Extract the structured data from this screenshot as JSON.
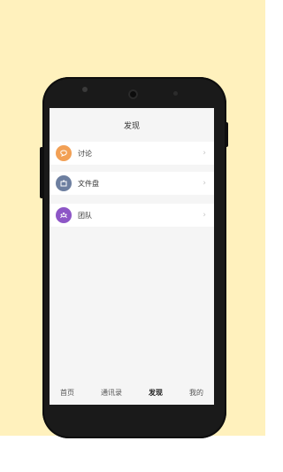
{
  "header": {
    "title": "发现"
  },
  "items": [
    {
      "label": "讨论",
      "icon": "discussion-icon",
      "color": "#f2a055"
    },
    {
      "label": "文件盘",
      "icon": "folder-icon",
      "color": "#6d7fa0"
    },
    {
      "label": "团队",
      "icon": "team-icon",
      "color": "#8d56c6"
    }
  ],
  "tabs": [
    {
      "label": "首页",
      "active": false
    },
    {
      "label": "通讯录",
      "active": false
    },
    {
      "label": "发现",
      "active": true
    },
    {
      "label": "我的",
      "active": false
    }
  ],
  "chevron": "›"
}
